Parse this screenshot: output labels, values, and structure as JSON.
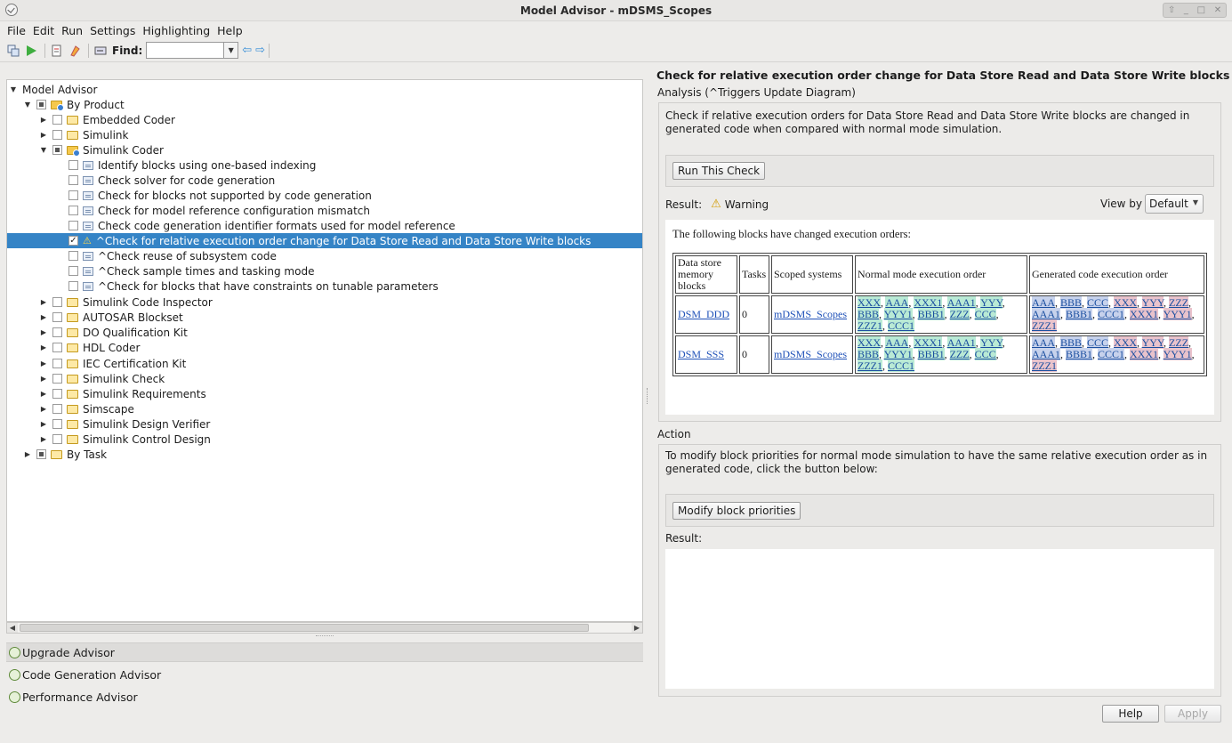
{
  "window": {
    "title": "Model Advisor - mDSMS_Scopes"
  },
  "menu": [
    "File",
    "Edit",
    "Run",
    "Settings",
    "Highlighting",
    "Help"
  ],
  "toolbar": {
    "find_label": "Find:",
    "find_value": ""
  },
  "tree": {
    "root": "Model Advisor",
    "by_product": "By Product",
    "embedded_coder": "Embedded Coder",
    "simulink": "Simulink",
    "simulink_coder": "Simulink Coder",
    "checks": [
      "Identify blocks using one-based indexing",
      "Check solver for code generation",
      "Check for blocks not supported by code generation",
      "Check for model reference configuration mismatch",
      "Check code generation identifier formats used for model reference",
      "^Check for relative execution order change for Data Store Read and Data Store Write blocks",
      "^Check reuse of subsystem code",
      "^Check sample times and tasking mode",
      "^Check for blocks that have constraints on tunable parameters"
    ],
    "products": [
      "Simulink Code Inspector",
      "AUTOSAR Blockset",
      "DO Qualification Kit",
      "HDL Coder",
      "IEC Certification Kit",
      "Simulink Check",
      "Simulink Requirements",
      "Simscape",
      "Simulink Design Verifier",
      "Simulink Control Design"
    ],
    "by_task": "By Task"
  },
  "advisors": [
    "Upgrade Advisor",
    "Code Generation Advisor",
    "Performance Advisor"
  ],
  "details": {
    "title": "Check for relative execution order change for Data Store Read and Data Store Write blocks",
    "analysis_label": "Analysis (^Triggers Update Diagram)",
    "description": "Check if relative execution orders for Data Store Read and Data Store Write blocks are changed in generated code when compared with normal mode simulation.",
    "run_button": "Run This Check",
    "result_label": "Result:",
    "result_value": "Warning",
    "view_by_label": "View by",
    "view_by_value": "Default",
    "report": {
      "intro": "The following blocks have changed execution orders:",
      "headers": [
        "Data store memory blocks",
        "Tasks",
        "Scoped systems",
        "Normal mode execution order",
        "Generated code execution order"
      ],
      "rows": [
        {
          "block": "DSM_DDD",
          "tasks": "0",
          "system": "mDSMS_Scopes",
          "normal": [
            "XXX",
            "AAA",
            "XXX1",
            "AAA1",
            "YYY",
            "BBB",
            "YYY1",
            "BBB1",
            "ZZZ",
            "CCC",
            "ZZZ1",
            "CCC1"
          ],
          "generated": [
            "AAA",
            "BBB",
            "CCC",
            "XXX",
            "YYY",
            "ZZZ",
            "AAA1",
            "BBB1",
            "CCC1",
            "XXX1",
            "YYY1",
            "ZZZ1"
          ]
        },
        {
          "block": "DSM_SSS",
          "tasks": "0",
          "system": "mDSMS_Scopes",
          "normal": [
            "XXX",
            "AAA",
            "XXX1",
            "AAA1",
            "YYY",
            "BBB",
            "YYY1",
            "BBB1",
            "ZZZ",
            "CCC",
            "ZZZ1",
            "CCC1"
          ],
          "generated": [
            "AAA",
            "BBB",
            "CCC",
            "XXX",
            "YYY",
            "ZZZ",
            "AAA1",
            "BBB1",
            "CCC1",
            "XXX1",
            "YYY1",
            "ZZZ1"
          ]
        }
      ]
    },
    "action_label": "Action",
    "action_description": "To modify block priorities for normal mode simulation to have the same relative execution order as in generated code, click the button below:",
    "action_button": "Modify block priorities",
    "action_result_label": "Result:"
  },
  "footer": {
    "help": "Help",
    "apply": "Apply"
  },
  "colors": {
    "selection": "#3584c6",
    "warning": "#e0a000",
    "link": "#1f51b8"
  }
}
